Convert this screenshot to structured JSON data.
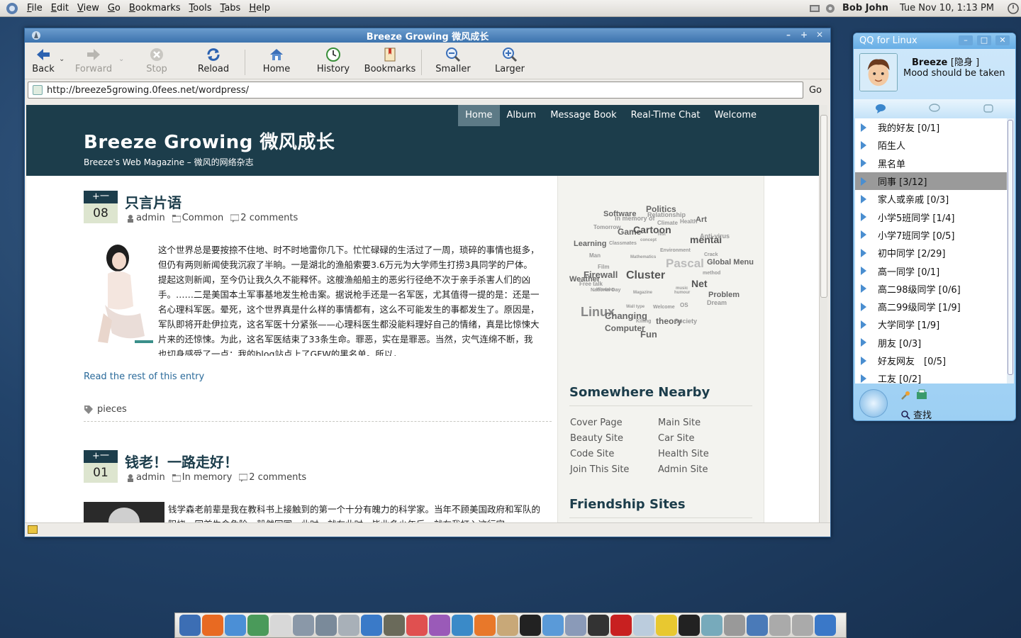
{
  "topbar": {
    "menus": [
      "File",
      "Edit",
      "View",
      "Go",
      "Bookmarks",
      "Tools",
      "Tabs",
      "Help"
    ],
    "user": "Bob John",
    "clock": "Tue Nov 10,  1:13 PM"
  },
  "browser": {
    "title": "Breeze Growing 微风成长",
    "toolbar": {
      "back": "Back",
      "forward": "Forward",
      "stop": "Stop",
      "reload": "Reload",
      "home": "Home",
      "history": "History",
      "bookmarks": "Bookmarks",
      "smaller": "Smaller",
      "larger": "Larger"
    },
    "url": "http://breeze5growing.0fees.net/wordpress/",
    "go": "Go"
  },
  "site": {
    "nav": [
      "Home",
      "Album",
      "Message Book",
      "Real-Time Chat",
      "Welcome"
    ],
    "title": "Breeze Growing 微风成长",
    "tagline": "Breeze's Web Magazine – 微风的网络杂志",
    "posts": [
      {
        "month": "+一",
        "day": "08",
        "title": "只言片语",
        "author": "admin",
        "category": "Common",
        "comments": "2 comments",
        "excerpt": "这个世界总是要按捺不住地、时不时地雷你几下。忙忙碌碌的生活过了一周，琐碎的事情也挺多，但仍有两则新闻使我沉寂了半晌。一是湖北的渔船索要3.6万元为大学师生打捞3具同学的尸体。提起这则新闻，至今仍让我久久不能释怀。这艘渔船船主的恶劣行径绝不次于亲手杀害人们的凶手。……二是美国本土军事基地发生枪击案。据说枪手还是一名军医，尤其值得一提的是：还是一名心理科军医。晕死，这个世界真是什么样的事情都有，这么不可能发生的事都发生了。原因是，军队即将开赴伊拉克，这名军医十分紧张——心理科医生都没能料理好自己的情绪，真是比惊悚大片来的还惊悚。为此，这名军医结束了33条生命。罪恶，实在是罪恶。当然，灾气连绵不断，我也切身感受了一点：我的blog站点上了GFW的黑名单。所以，",
        "read_more": "Read the rest of this entry",
        "tags": "pieces"
      },
      {
        "month": "+一",
        "day": "01",
        "title": "钱老！一路走好！",
        "author": "admin",
        "category": "In memory",
        "comments": "2 comments",
        "excerpt": "钱学森老前辈是我在教科书上接触到的第一个十分有魄力的科学家。当年不顾美国政府和军队的阻挠，回首生命危险，毅然回国。此时，就在此时，毕业多少年后，就在我打入这行宫"
      }
    ],
    "tag_cloud": [
      "Politics",
      "Software",
      "Relationship",
      "In memory of",
      "Art",
      "Climate",
      "Health",
      "Game",
      "Cartoon",
      "Tomorrow",
      "Learning",
      "mental",
      "Anti-virus",
      "Classmates",
      "Man",
      "Crack",
      "Global Menu",
      "Pascal",
      "Film",
      "Firewall",
      "Cluster",
      "Weather",
      "method",
      "Free talk",
      "Net",
      "National Day",
      "Problem",
      "Dream",
      "Linux",
      "Changing",
      "theory",
      "Society",
      "Computer",
      "Fun",
      "Windows",
      "Magazine",
      "humour",
      "Welcome",
      "Wall type",
      "Killing",
      "Environment",
      "concept",
      "Mathematics",
      "Test",
      "OS",
      "music"
    ],
    "sidebar": {
      "nearby_title": "Somewhere Nearby",
      "links": [
        "Cover Page",
        "Main Site",
        "Beauty Site",
        "Car Site",
        "Code Site",
        "Health Site",
        "Join This Site",
        "Admin Site"
      ],
      "friends_title": "Friendship Sites"
    }
  },
  "qq": {
    "title": "QQ for Linux",
    "name": "Breeze",
    "status": "[隐身 ]",
    "mood": "Mood should be taken",
    "groups": [
      "我的好友 [0/1]",
      "陌生人",
      "黑名单",
      "同事 [3/12]",
      "家人或亲戚 [0/3]",
      "小学5班同学 [1/4]",
      "小学7班同学 [0/5]",
      "初中同学 [2/29]",
      "高一同学 [0/1]",
      "高二98级同学 [0/6]",
      "高二99级同学 [1/9]",
      "大学同学 [1/9]",
      "朋友 [0/3]",
      "好友网友　[0/5]",
      "工友 [0/2]"
    ],
    "find": "查找"
  },
  "colors": {
    "header_bg": "#1c3d4b",
    "title_bar": "#3c73ae",
    "link": "#2a6a9a",
    "date_day_bg": "#dde5cf"
  }
}
